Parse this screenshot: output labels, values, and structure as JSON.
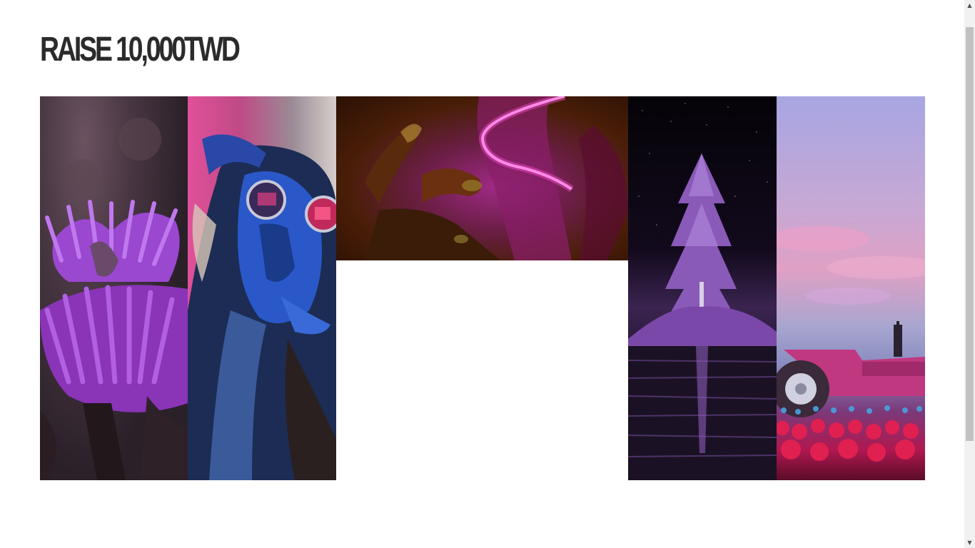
{
  "page": {
    "title": "RAISE 10,000TWD"
  },
  "gallery": {
    "images": [
      {
        "subject": "purple flower"
      },
      {
        "subject": "woman with neon glasses"
      },
      {
        "subject": "hand with neon light"
      },
      {
        "subject": "purple tree on island"
      },
      {
        "subject": "pink tractor in tulip field"
      }
    ]
  },
  "scrollbar": {
    "up_icon": "triangle-up-icon",
    "down_icon": "triangle-down-icon",
    "up_glyph": "▲",
    "down_glyph": "▼"
  },
  "colors": {
    "title": "#2b2b2b",
    "background": "#ffffff",
    "scroll_thumb": "#c1c1c1"
  }
}
